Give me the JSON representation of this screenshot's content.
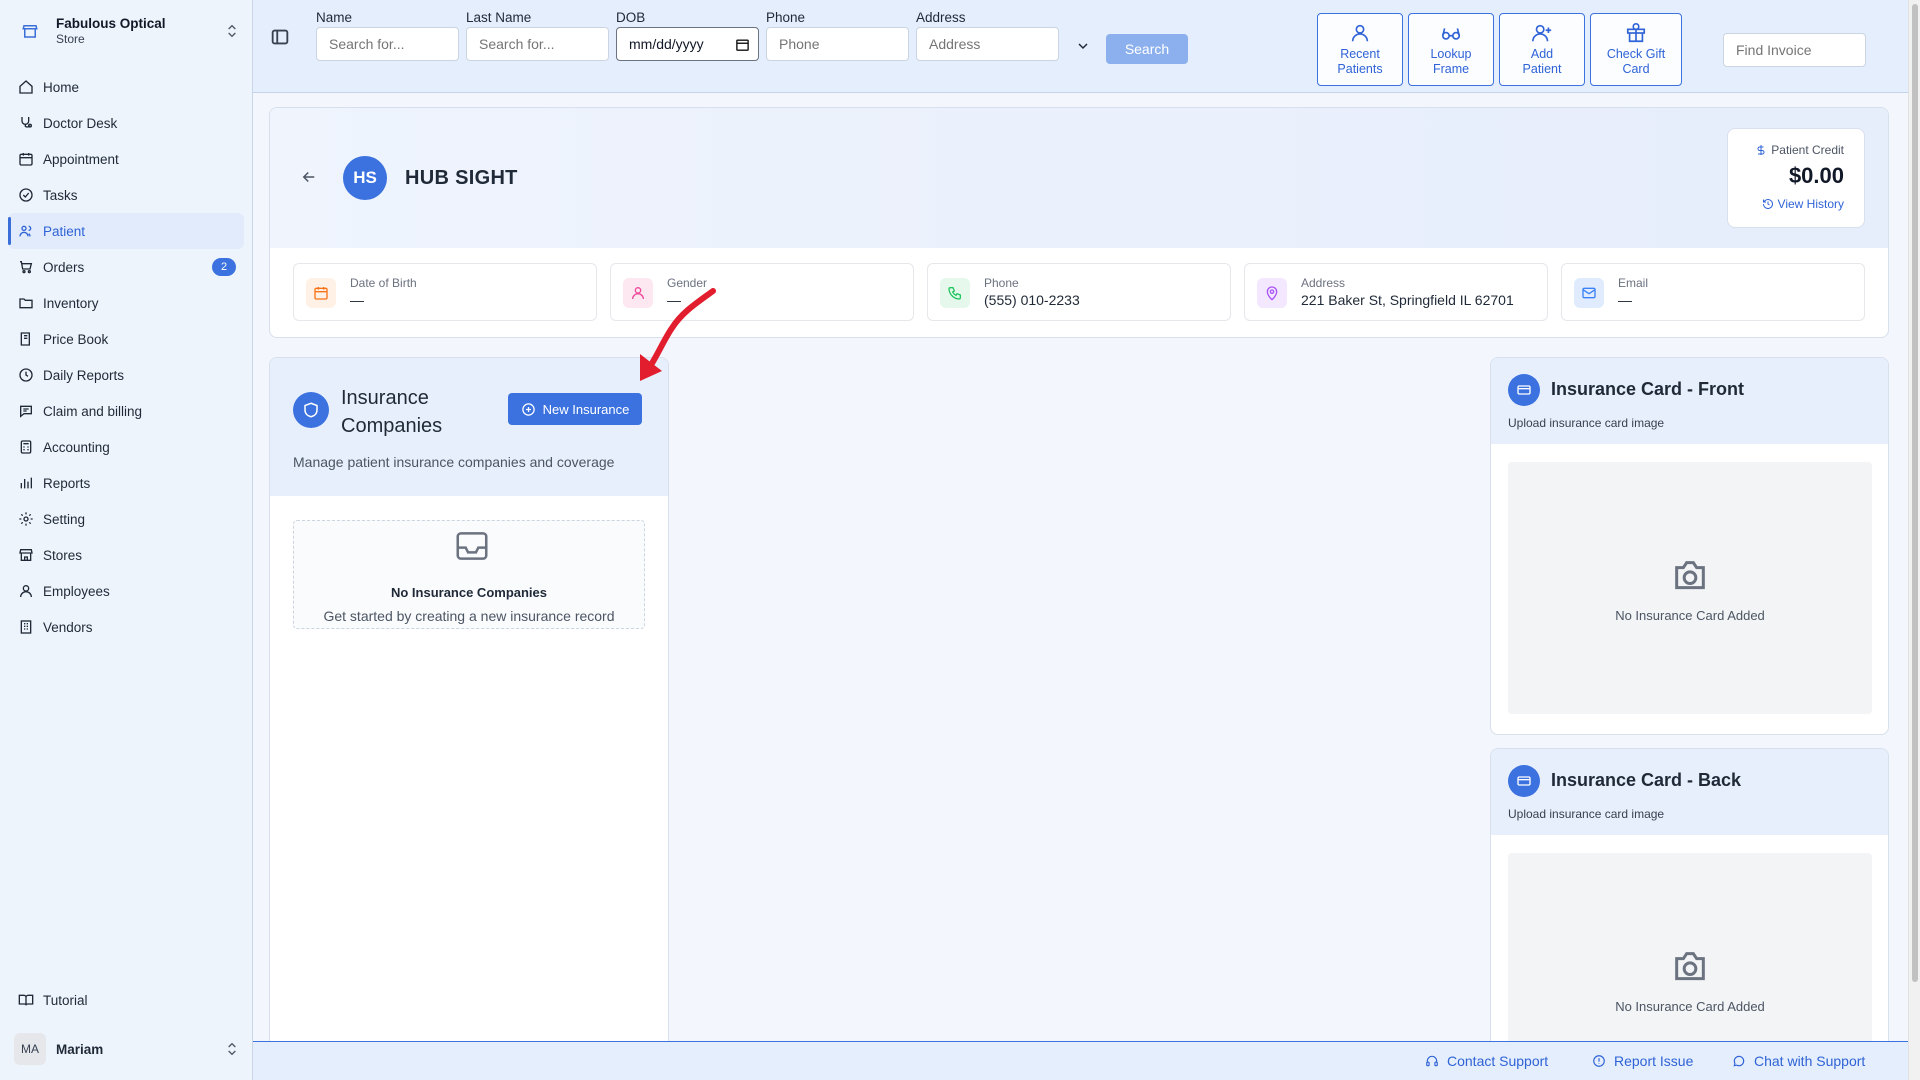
{
  "store": {
    "name": "Fabulous Optical",
    "type": "Store"
  },
  "nav": [
    {
      "label": "Home",
      "icon": "home-icon"
    },
    {
      "label": "Doctor Desk",
      "icon": "stethoscope-icon"
    },
    {
      "label": "Appointment",
      "icon": "calendar-icon"
    },
    {
      "label": "Tasks",
      "icon": "check-circle-icon"
    },
    {
      "label": "Patient",
      "icon": "users-icon",
      "active": true
    },
    {
      "label": "Orders",
      "icon": "cart-icon",
      "badge": "2"
    },
    {
      "label": "Inventory",
      "icon": "folder-icon"
    },
    {
      "label": "Price Book",
      "icon": "book-icon"
    },
    {
      "label": "Daily Reports",
      "icon": "clock-icon"
    },
    {
      "label": "Claim and billing",
      "icon": "message-icon"
    },
    {
      "label": "Accounting",
      "icon": "calculator-icon"
    },
    {
      "label": "Reports",
      "icon": "bar-chart-icon"
    },
    {
      "label": "Setting",
      "icon": "gear-icon"
    },
    {
      "label": "Stores",
      "icon": "store-icon"
    },
    {
      "label": "Employees",
      "icon": "user-icon"
    },
    {
      "label": "Vendors",
      "icon": "building-icon"
    }
  ],
  "tutorial_label": "Tutorial",
  "user": {
    "initials": "MA",
    "name": "Mariam"
  },
  "search": {
    "name_label": "Name",
    "name_placeholder": "Search for...",
    "lastname_label": "Last Name",
    "lastname_placeholder": "Search for...",
    "dob_label": "DOB",
    "dob_value": "mm/dd/yyyy",
    "phone_label": "Phone",
    "phone_placeholder": "Phone",
    "address_label": "Address",
    "address_placeholder": "Address",
    "search_button": "Search"
  },
  "quick_actions": [
    {
      "line1": "Recent",
      "line2": "Patients",
      "icon": "user-icon"
    },
    {
      "line1": "Lookup",
      "line2": "Frame",
      "icon": "glasses-icon"
    },
    {
      "line1": "Add",
      "line2": "Patient",
      "icon": "user-plus-icon"
    },
    {
      "line1": "Check Gift",
      "line2": "Card",
      "icon": "gift-icon"
    }
  ],
  "find_invoice_placeholder": "Find Invoice",
  "patient": {
    "initials": "HS",
    "name": "HUB SIGHT",
    "credit_label": "Patient Credit",
    "credit_value": "$0.00",
    "view_history": "View History",
    "info": [
      {
        "label": "Date of Birth",
        "value": "—",
        "icon": "calendar-icon",
        "color": "#f97316"
      },
      {
        "label": "Gender",
        "value": "—",
        "icon": "user-icon",
        "color": "#ec4899"
      },
      {
        "label": "Phone",
        "value": "(555) 010-2233",
        "icon": "phone-icon",
        "color": "#22c55e"
      },
      {
        "label": "Address",
        "value": "221 Baker St, Springfield IL 62701",
        "icon": "map-pin-icon",
        "color": "#a855f7"
      },
      {
        "label": "Email",
        "value": "—",
        "icon": "mail-icon",
        "color": "#3b82f6"
      }
    ]
  },
  "insurance": {
    "title": "Insurance Companies",
    "new_button": "New Insurance",
    "description": "Manage patient insurance companies and coverage",
    "empty_title": "No Insurance Companies",
    "empty_sub": "Get started by creating a new insurance record"
  },
  "cards": {
    "front_title": "Insurance Card - Front",
    "back_title": "Insurance Card - Back",
    "subtitle": "Upload insurance card image",
    "empty_text": "No Insurance Card Added"
  },
  "footer": {
    "contact": "Contact Support",
    "report": "Report Issue",
    "chat": "Chat with Support"
  },
  "colors": {
    "accent": "#3b72df",
    "annotation": "#e11d2e"
  }
}
